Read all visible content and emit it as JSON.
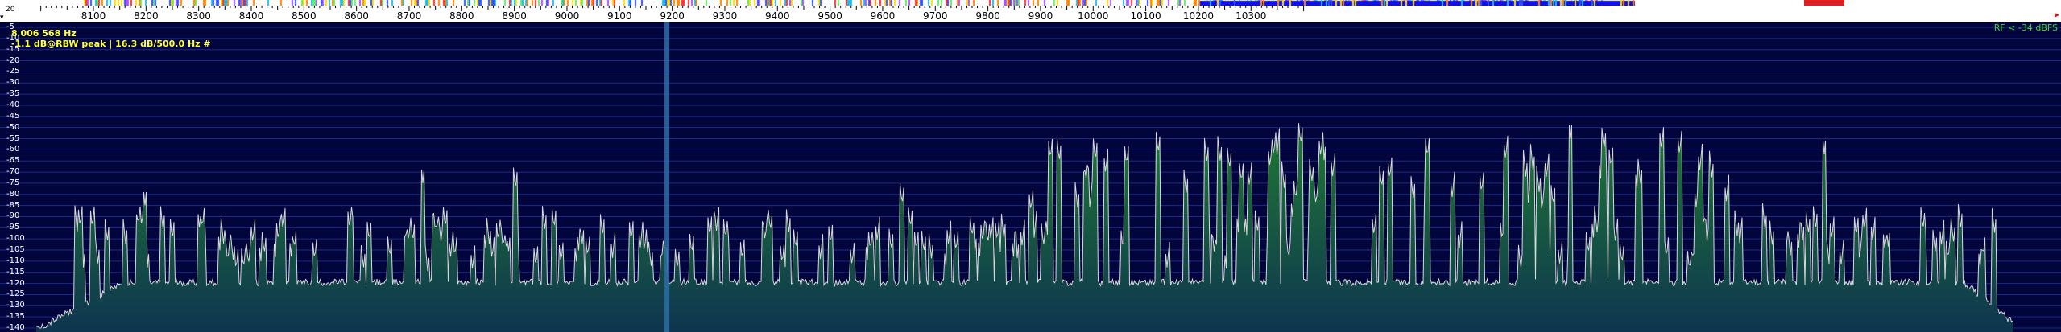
{
  "frequency_axis": {
    "unit": "Hz",
    "tick_labels": [
      "8100",
      "8200",
      "8300",
      "8400",
      "8500",
      "8600",
      "8700",
      "8800",
      "8900",
      "9000",
      "9100",
      "9200",
      "9300",
      "9400",
      "9500",
      "9600",
      "9700",
      "9800",
      "9900",
      "10000",
      "10100",
      "10200",
      "10300"
    ],
    "left_marker": "20"
  },
  "db_axis": {
    "labels": [
      "-5",
      "-10",
      "-15",
      "-20",
      "-25",
      "-30",
      "-35",
      "-40",
      "-45",
      "-50",
      "-55",
      "-60",
      "-65",
      "-70",
      "-75",
      "-80",
      "-85",
      "-90",
      "-95",
      "-100",
      "-105",
      "-110",
      "-115",
      "-120",
      "-125",
      "-130",
      "-135",
      "-140"
    ]
  },
  "readout": {
    "frequency": "8 006 568 Hz",
    "measurement": "-1.1 dB@RBW peak |  16.3 dB/500.0 Hz #"
  },
  "rf_status": "RF < -34 dBFS",
  "colors": {
    "background": "#02053c",
    "grid": "#1b2a8a",
    "trace": "#d8d8d8",
    "fill_top": "#1f7a34",
    "fill_bottom": "#0e3550",
    "readout": "#ffff44",
    "rf_status": "#3ad43a",
    "marker": "#2c6ea8"
  },
  "icons": [
    "collapse-icon",
    "scroll-right-icon"
  ]
}
